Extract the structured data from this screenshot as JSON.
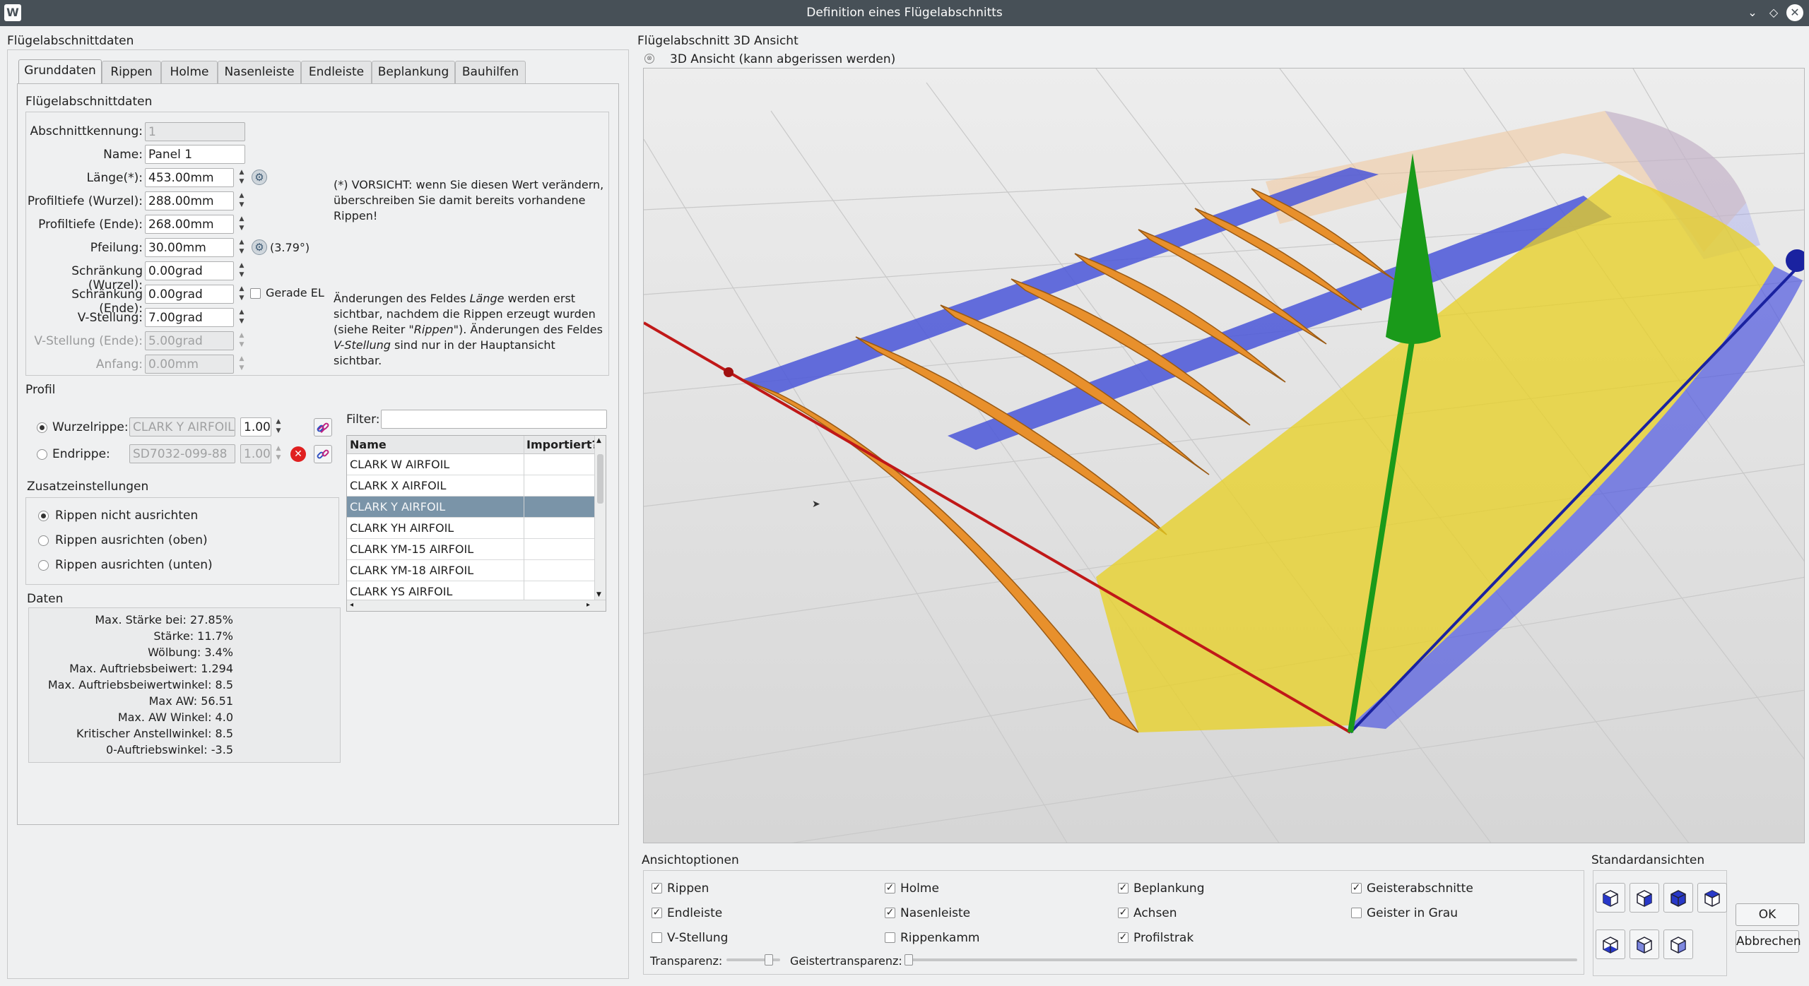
{
  "window": {
    "title": "Definition eines Flügelabschnitts",
    "icon": "app-icon"
  },
  "left": {
    "header": "Flügelabschnittdaten",
    "tabs": [
      {
        "label": "Grunddaten",
        "active": true
      },
      {
        "label": "Rippen"
      },
      {
        "label": "Holme"
      },
      {
        "label": "Nasenleiste"
      },
      {
        "label": "Endleiste"
      },
      {
        "label": "Beplankung"
      },
      {
        "label": "Bauhilfen"
      }
    ],
    "section_title": "Flügelabschnittdaten",
    "fields": {
      "abschnittkennung": {
        "label": "Abschnittkennung:",
        "value": "1"
      },
      "name": {
        "label": "Name:",
        "value": "Panel 1"
      },
      "laenge": {
        "label": "Länge(*):",
        "value": "453.00mm"
      },
      "profiltiefe_wurzel": {
        "label": "Profiltiefe (Wurzel):",
        "value": "288.00mm"
      },
      "profiltiefe_ende": {
        "label": "Profiltiefe (Ende):",
        "value": "268.00mm"
      },
      "pfeilung": {
        "label": "Pfeilung:",
        "value": "30.00mm",
        "extra": "(3.79°)"
      },
      "schraenkung_wurzel": {
        "label": "Schränkung (Wurzel):",
        "value": "0.00grad"
      },
      "schraenkung_ende": {
        "label": "Schränkung (Ende):",
        "value": "0.00grad"
      },
      "gerade_el": {
        "label": "Gerade EL"
      },
      "v_stellung": {
        "label": "V-Stellung:",
        "value": "7.00grad"
      },
      "v_stellung_ende": {
        "label": "V-Stellung (Ende):",
        "value": "5.00grad"
      },
      "anfang": {
        "label": "Anfang:",
        "value": "0.00mm"
      }
    },
    "note1": "(*) VORSICHT: wenn Sie diesen Wert verändern, überschreiben Sie damit bereits vorhandene Rippen!",
    "note2": {
      "p1": "Änderungen des Feldes ",
      "em1": "Länge",
      "p2": " werden erst sichtbar, nachdem die Rippen erzeugt wurden (siehe Reiter \"",
      "em2": "Rippen",
      "p3": "\"). Änderungen des Feldes ",
      "em3": "V-Stellung",
      "p4": " sind nur in der Hauptansicht sichtbar."
    },
    "profil": {
      "title": "Profil",
      "wurzelrippe": {
        "label": "Wurzelrippe:",
        "value": "CLARK Y AIRFOIL",
        "factor": "1.00"
      },
      "endrippe": {
        "label": "Endrippe:",
        "value": "SD7032-099-88",
        "factor": "1.00"
      },
      "filter_label": "Filter:",
      "filter_value": "",
      "table": {
        "columns": [
          "Name",
          "Importiert?"
        ],
        "rows": [
          "CLARK W AIRFOIL",
          "CLARK X AIRFOIL",
          "CLARK Y AIRFOIL",
          "CLARK YH AIRFOIL",
          "CLARK YM-15 AIRFOIL",
          "CLARK YM-18 AIRFOIL",
          "CLARK YS AIRFOIL"
        ],
        "selected_index": 2
      }
    },
    "zusatz": {
      "title": "Zusatzeinstellungen",
      "options": [
        "Rippen nicht ausrichten",
        "Rippen ausrichten (oben)",
        "Rippen ausrichten (unten)"
      ],
      "selected_index": 0
    },
    "daten": {
      "title": "Daten",
      "rows": [
        "Max. Stärke bei: 27.85%",
        "Stärke: 11.7%",
        "Wölbung: 3.4%",
        "Max. Auftriebsbeiwert: 1.294",
        "Max. Auftriebsbeiwertwinkel: 8.5",
        "Max AW: 56.51",
        "Max. AW Winkel: 4.0",
        "Kritischer Anstellwinkel: 8.5",
        "0-Auftriebswinkel: -3.5"
      ]
    }
  },
  "right": {
    "header": "Flügelabschnitt 3D Ansicht",
    "dock_title": "3D Ansicht (kann abgerissen werden)",
    "ansicht": {
      "title": "Ansichtoptionen",
      "checks": [
        {
          "label": "Rippen",
          "checked": true
        },
        {
          "label": "Holme",
          "checked": true
        },
        {
          "label": "Beplankung",
          "checked": true
        },
        {
          "label": "Geisterabschnitte",
          "checked": true
        },
        {
          "label": "Endleiste",
          "checked": true
        },
        {
          "label": "Nasenleiste",
          "checked": true
        },
        {
          "label": "Achsen",
          "checked": true
        },
        {
          "label": "Geister in Grau",
          "checked": false
        },
        {
          "label": "V-Stellung",
          "checked": false
        },
        {
          "label": "Rippenkamm",
          "checked": false
        },
        {
          "label": "Profilstrak",
          "checked": true
        }
      ],
      "transparenz_label": "Transparenz:",
      "transparenz_value": 0.85,
      "geister_label": "Geistertransparenz:",
      "geister_value": 0.0
    },
    "standard": {
      "title": "Standardansichten"
    },
    "ok": "OK",
    "cancel": "Abbrechen"
  },
  "colors": {
    "rib": "#e8902c",
    "spar": "#4a56d8",
    "sheeting": "#e8d020",
    "axis_x": "#c01818",
    "axis_y": "#1a9a1a",
    "axis_z": "#1a22a0",
    "selection": "#7a94a8"
  }
}
